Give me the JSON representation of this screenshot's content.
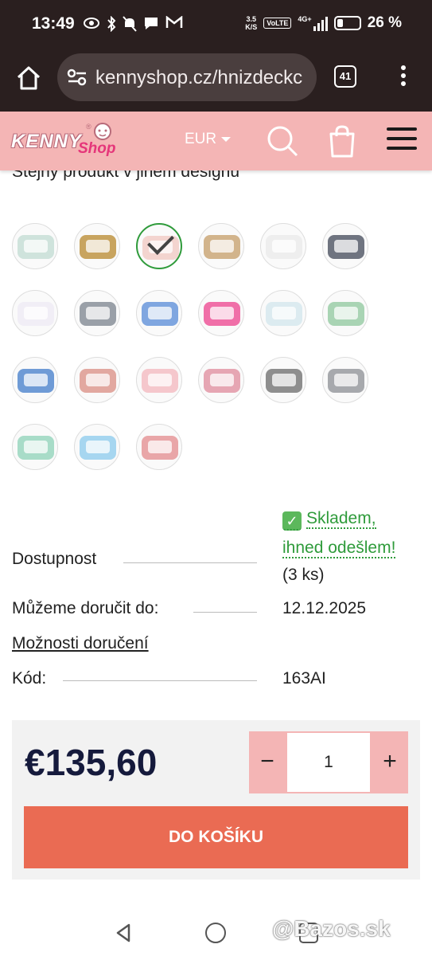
{
  "status_bar": {
    "time": "13:49",
    "net_speed_top": "3.5",
    "net_speed_bottom": "K/S",
    "volte": "VoLTE",
    "network": "4G+",
    "battery": "26 %",
    "left_icons": [
      "eye-icon",
      "bluetooth-icon",
      "mute-icon",
      "chat-icon",
      "gmail-icon"
    ]
  },
  "browser": {
    "url": "kennyshop.cz/hnizdeckc",
    "tab_count": "41"
  },
  "header": {
    "logo_kenny": "KENNY",
    "logo_shop": "Shop",
    "logo_reg": "®",
    "currency": "EUR"
  },
  "product": {
    "design_title": "Stejný produkt v jiném designu",
    "swatches": [
      {
        "color": "#cfe3dc",
        "active": false
      },
      {
        "color": "#c8a45f",
        "active": false
      },
      {
        "color": "#f3d4cf",
        "active": true
      },
      {
        "color": "#d2b48c",
        "active": false
      },
      {
        "color": "#eeeeee",
        "active": false
      },
      {
        "color": "#6f7480",
        "active": false
      },
      {
        "color": "#f1eef6",
        "active": false
      },
      {
        "color": "#9aa0a8",
        "active": false
      },
      {
        "color": "#7fa6e0",
        "active": false
      },
      {
        "color": "#f06fa8",
        "active": false
      },
      {
        "color": "#dcebf0",
        "active": false
      },
      {
        "color": "#a9d4b4",
        "active": false
      },
      {
        "color": "#6f9bd6",
        "active": false
      },
      {
        "color": "#e2a8a0",
        "active": false
      },
      {
        "color": "#f5c7cc",
        "active": false
      },
      {
        "color": "#e6a6b3",
        "active": false
      },
      {
        "color": "#8e8e8e",
        "active": false
      },
      {
        "color": "#a7a9ad",
        "active": false
      },
      {
        "color": "#a8dcc8",
        "active": false
      },
      {
        "color": "#a6d6f0",
        "active": false
      },
      {
        "color": "#e9a6a8",
        "active": false
      }
    ],
    "availability_label": "Dostupnost",
    "availability_line1": "Skladem,",
    "availability_line2": "ihned odešlem!",
    "availability_qty": "(3 ks)",
    "check_icon": "check-mark-icon",
    "delivery_label": "Můžeme doručit do:",
    "delivery_date": "12.12.2025",
    "delivery_options_link": "Možnosti doručení",
    "code_label": "Kód:",
    "code_value": "163AI"
  },
  "buy": {
    "price": "€135,60",
    "qty_minus": "−",
    "qty_value": "1",
    "qty_plus": "+",
    "add_to_cart": "DO KOŠÍKU"
  },
  "watermark": "@Bazos.sk"
}
